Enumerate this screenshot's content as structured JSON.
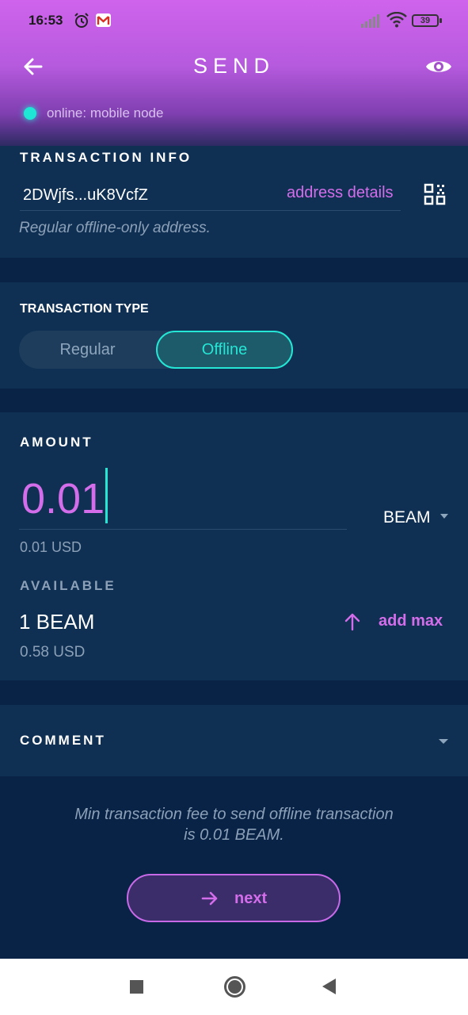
{
  "status_bar": {
    "time": "16:53",
    "battery": "39"
  },
  "header": {
    "title": "SEND",
    "node_status": "online: mobile node"
  },
  "transaction_info": {
    "title": "TRANSACTION INFO",
    "address": "2DWjfs...uK8VcfZ",
    "address_details_label": "address details",
    "address_note": "Regular offline-only address."
  },
  "transaction_type": {
    "title": "TRANSACTION TYPE",
    "options": [
      {
        "label": "Regular"
      },
      {
        "label": "Offline"
      }
    ],
    "selected": "Offline"
  },
  "amount": {
    "title": "AMOUNT",
    "value": "0.01",
    "currency": "BEAM",
    "usd": "0.01 USD",
    "available_label": "AVAILABLE",
    "available_value": "1 BEAM",
    "available_usd": "0.58 USD",
    "add_max_label": "add max"
  },
  "comment": {
    "title": "COMMENT"
  },
  "fee_note": {
    "line1": "Min transaction fee to send offline transaction",
    "line2": "is 0.01 BEAM."
  },
  "next_button": {
    "label": "next"
  },
  "colors": {
    "accent_purple": "#d36dea",
    "accent_teal": "#25e6d4",
    "background": "#082346",
    "panel": "#0f3053"
  }
}
